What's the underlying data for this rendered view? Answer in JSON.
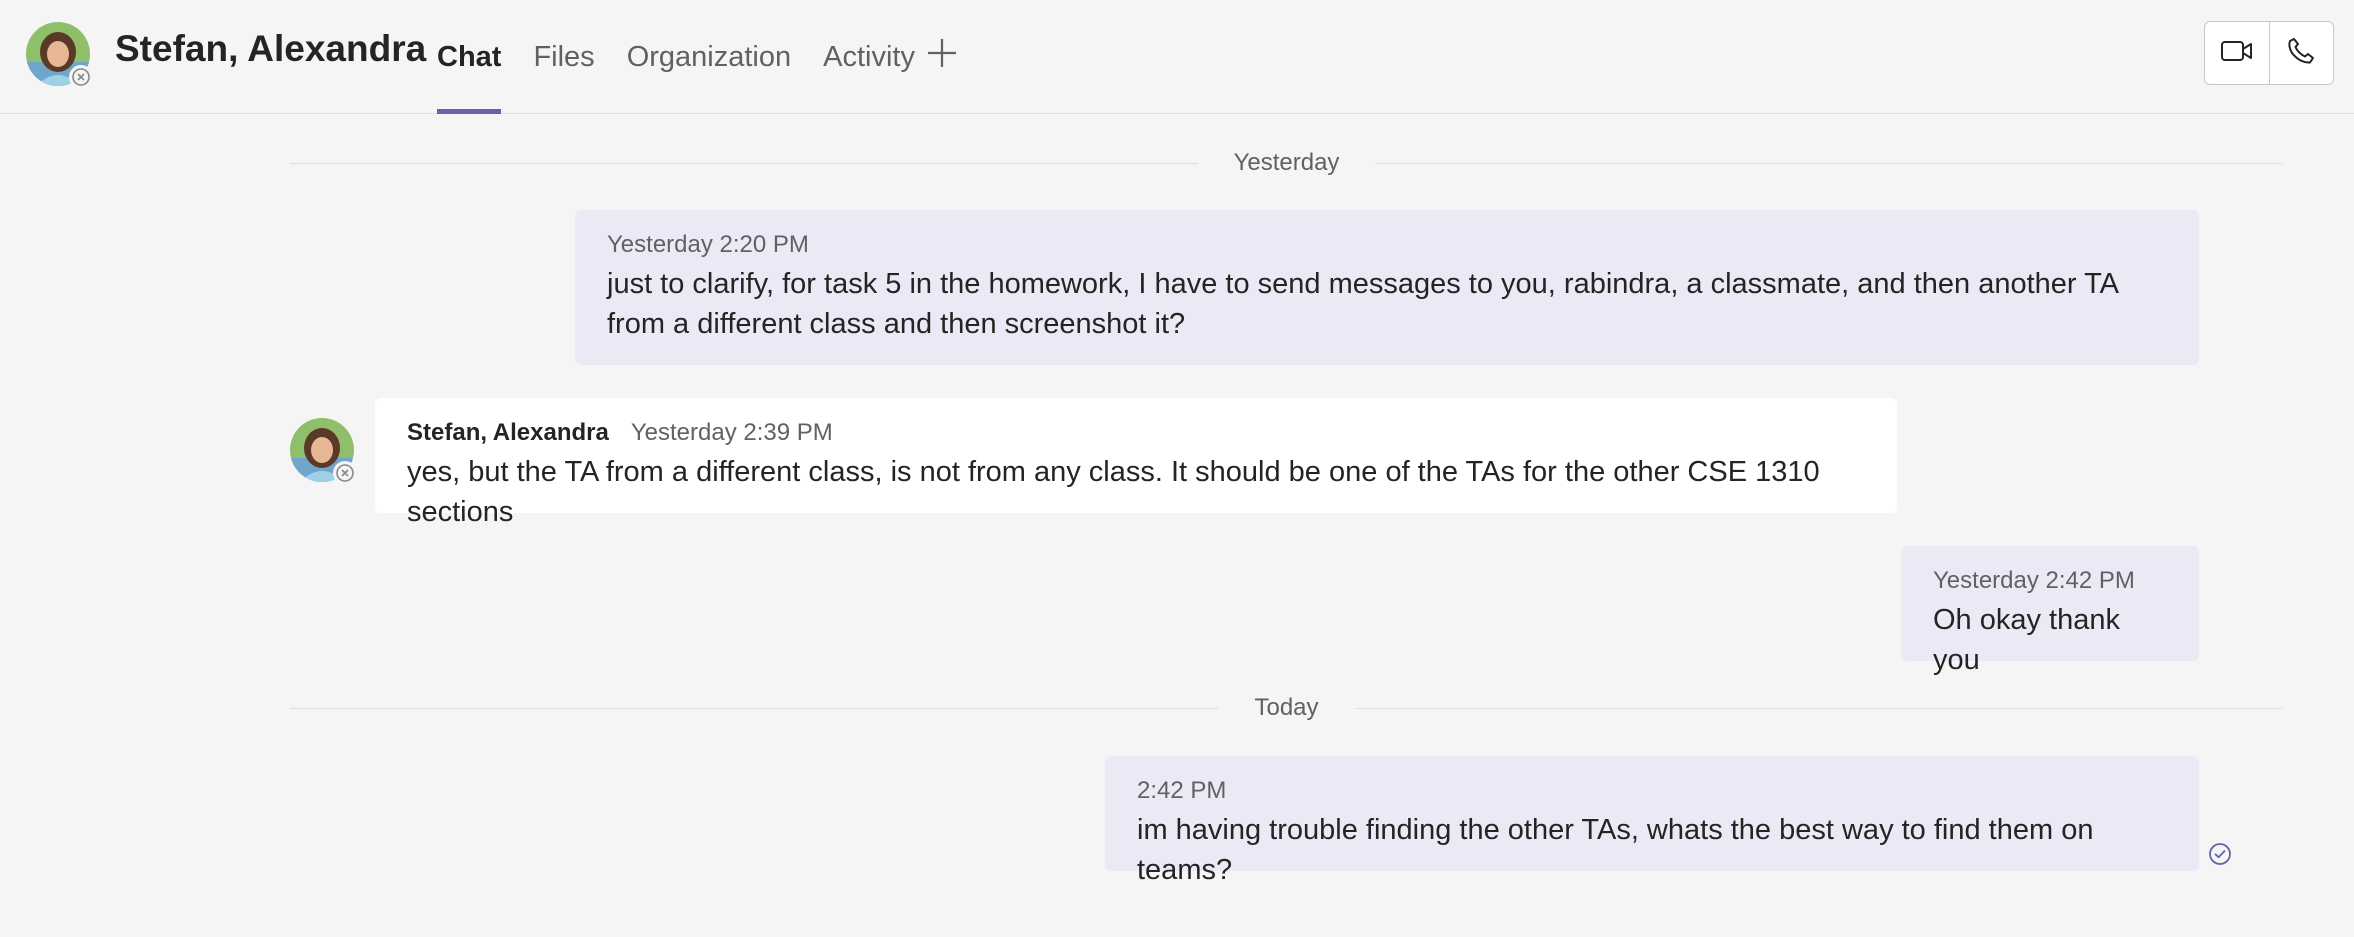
{
  "header": {
    "title": "Stefan, Alexandra",
    "tabs": [
      {
        "label": "Chat",
        "active": true
      },
      {
        "label": "Files",
        "active": false
      },
      {
        "label": "Organization",
        "active": false
      },
      {
        "label": "Activity",
        "active": false
      }
    ],
    "add_tab_icon": "plus-icon",
    "video_call_icon": "video-camera-icon",
    "audio_call_icon": "phone-icon",
    "accent_color": "#6264a7"
  },
  "chat": {
    "dividers": [
      "Yesterday",
      "Today"
    ],
    "messages": [
      {
        "from_me": true,
        "timestamp": "Yesterday 2:20 PM",
        "text": "just to clarify, for task 5 in the homework, I have to send messages to you, rabindra, a classmate, and then another TA from a different class and then screenshot it?"
      },
      {
        "from_me": false,
        "author": "Stefan, Alexandra",
        "timestamp": "Yesterday 2:39 PM",
        "text": "yes, but the TA from a different class, is not from any class. It should be one of the TAs for the other CSE 1310 sections"
      },
      {
        "from_me": true,
        "timestamp": "Yesterday 2:42 PM",
        "text": "Oh okay thank you"
      },
      {
        "from_me": true,
        "timestamp": "2:42 PM",
        "text": "im having trouble finding the other TAs, whats the best way to find them on teams?"
      }
    ],
    "read_receipt_icon": "check-circle-icon"
  }
}
